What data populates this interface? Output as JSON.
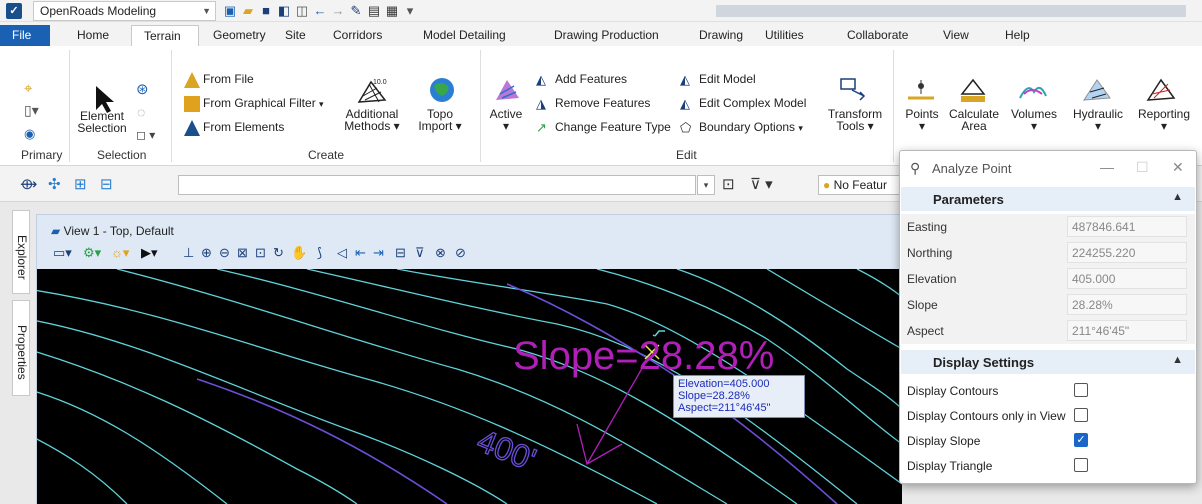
{
  "app": {
    "workflow": "OpenRoads Modeling"
  },
  "tabs": [
    "File",
    "Home",
    "Terrain",
    "Geometry",
    "Site",
    "Corridors",
    "Model Detailing",
    "Drawing Production",
    "Drawing",
    "Utilities",
    "Collaborate",
    "View",
    "Help"
  ],
  "active_tab": "Terrain",
  "ribbon": {
    "primary": {
      "label": "Primary"
    },
    "selection": {
      "label": "Selection",
      "element_selection": "Element Selection"
    },
    "create": {
      "label": "Create",
      "from_file": "From File",
      "from_graphical_filter": "From Graphical Filter",
      "from_elements": "From Elements",
      "additional_methods": "Additional Methods",
      "topo_import": "Topo Import"
    },
    "edit": {
      "label": "Edit",
      "active": "Active",
      "add_features": "Add Features",
      "remove_features": "Remove Features",
      "change_feature_type": "Change Feature Type",
      "edit_model": "Edit Model",
      "edit_complex_model": "Edit Complex Model",
      "boundary_options": "Boundary Options",
      "transform_tools": "Transform Tools"
    },
    "analysis": {
      "points": "Points",
      "calculate_area": "Calculate Area",
      "volumes": "Volumes",
      "hydraulic": "Hydraulic",
      "reporting": "Reporting"
    }
  },
  "toolrow": {
    "feature_picker": "No Featur"
  },
  "side_tabs": {
    "explorer": "Explorer",
    "properties": "Properties"
  },
  "view": {
    "title": "View 1 - Top, Default",
    "slope_label": "Slope=28.28%",
    "contour_label": "400'",
    "tooltip": {
      "line1": "Elevation=405.000",
      "line2": "Slope=28.28%",
      "line3": "Aspect=211°46'45\""
    }
  },
  "dialog": {
    "title": "Analyze Point",
    "parameters": {
      "header": "Parameters",
      "rows": [
        {
          "label": "Easting",
          "value": "487846.641"
        },
        {
          "label": "Northing",
          "value": "224255.220"
        },
        {
          "label": "Elevation",
          "value": "405.000"
        },
        {
          "label": "Slope",
          "value": "28.28%"
        },
        {
          "label": "Aspect",
          "value": "211°46'45\""
        }
      ]
    },
    "display_settings": {
      "header": "Display Settings",
      "rows": [
        {
          "label": "Display Contours",
          "checked": false
        },
        {
          "label": "Display Contours only in View",
          "checked": false
        },
        {
          "label": "Display Slope",
          "checked": true
        },
        {
          "label": "Display Triangle",
          "checked": false
        }
      ]
    }
  },
  "colors": {
    "accent": "#1a61b4",
    "contour": "#5fd3d9",
    "major_contour": "#6b4fd8",
    "slope_text": "#b020b8"
  }
}
